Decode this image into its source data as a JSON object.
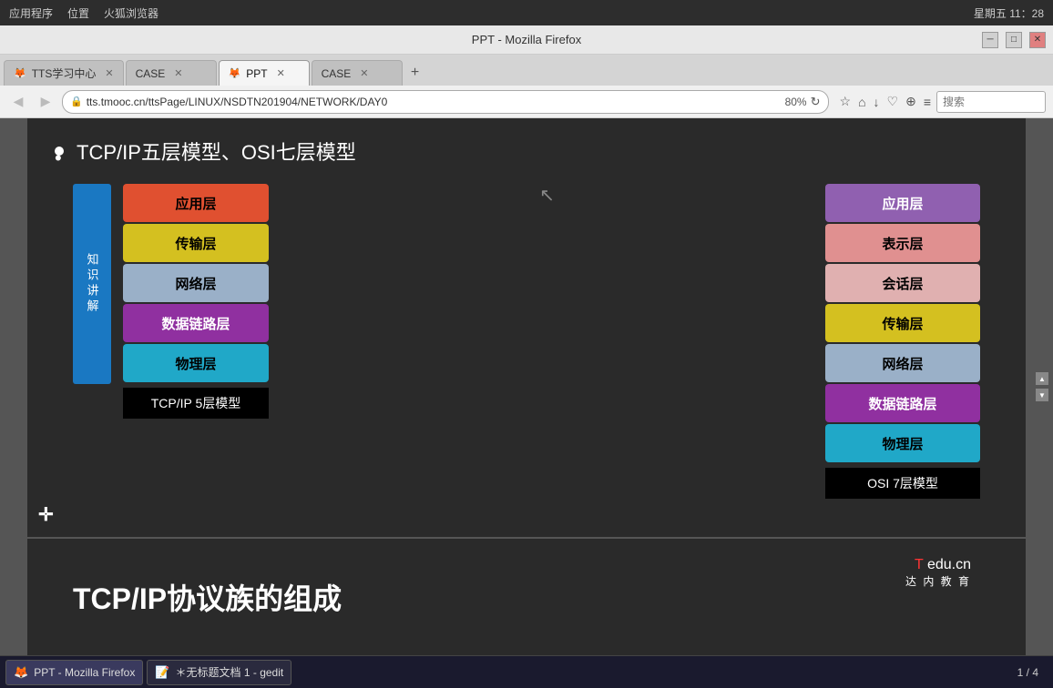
{
  "os": {
    "topbar_left": [
      "应用程序",
      "位置",
      "火狐浏览器"
    ],
    "topbar_right": "星期五 11：28"
  },
  "browser": {
    "title": "PPT - Mozilla Firefox",
    "tabs": [
      {
        "id": "tts",
        "label": "TTS学习中心",
        "active": false
      },
      {
        "id": "case1",
        "label": "CASE",
        "active": false
      },
      {
        "id": "ppt",
        "label": "PPT",
        "active": true
      },
      {
        "id": "case2",
        "label": "CASE",
        "active": false
      }
    ],
    "address": "tts.tmooc.cn/ttsPage/LINUX/NSDTN201904/NETWORK/DAY0",
    "zoom": "80%",
    "search_placeholder": "搜索"
  },
  "slide1": {
    "title": "TCP/IP五层模型、OSI七层模型",
    "badge": "知识讲解",
    "tcp_model": {
      "label": "TCP/IP 5层模型",
      "layers": [
        {
          "name": "应用层",
          "color": "#e05030"
        },
        {
          "name": "传输层",
          "color": "#d4c020"
        },
        {
          "name": "网络层",
          "color": "#9ab0c8"
        },
        {
          "name": "数据链路层",
          "color": "#9030a0"
        },
        {
          "name": "物理层",
          "color": "#20a8c8"
        }
      ]
    },
    "osi_model": {
      "label": "OSI 7层模型",
      "layers": [
        {
          "name": "应用层",
          "color": "#9060b0"
        },
        {
          "name": "表示层",
          "color": "#e09090"
        },
        {
          "name": "会话层",
          "color": "#e0b0b0"
        },
        {
          "name": "传输层",
          "color": "#d4c020"
        },
        {
          "name": "网络层",
          "color": "#9ab0c8"
        },
        {
          "name": "数据链路层",
          "color": "#9030a0"
        },
        {
          "name": "物理层",
          "color": "#20a8c8"
        }
      ]
    }
  },
  "slide2": {
    "title": "TCP/IP协议族的组成",
    "logo_brand": "Tedu.cn",
    "logo_t": "T",
    "logo_rest": "edu.cn",
    "logo_subtitle": "达 内 教 育"
  },
  "taskbar": {
    "items": [
      {
        "id": "firefox",
        "label": "PPT - Mozilla Firefox",
        "active": true
      },
      {
        "id": "gedit",
        "label": "＊无标题文档 1 - gedit",
        "active": false
      }
    ],
    "page_indicator": "1 / 4"
  }
}
